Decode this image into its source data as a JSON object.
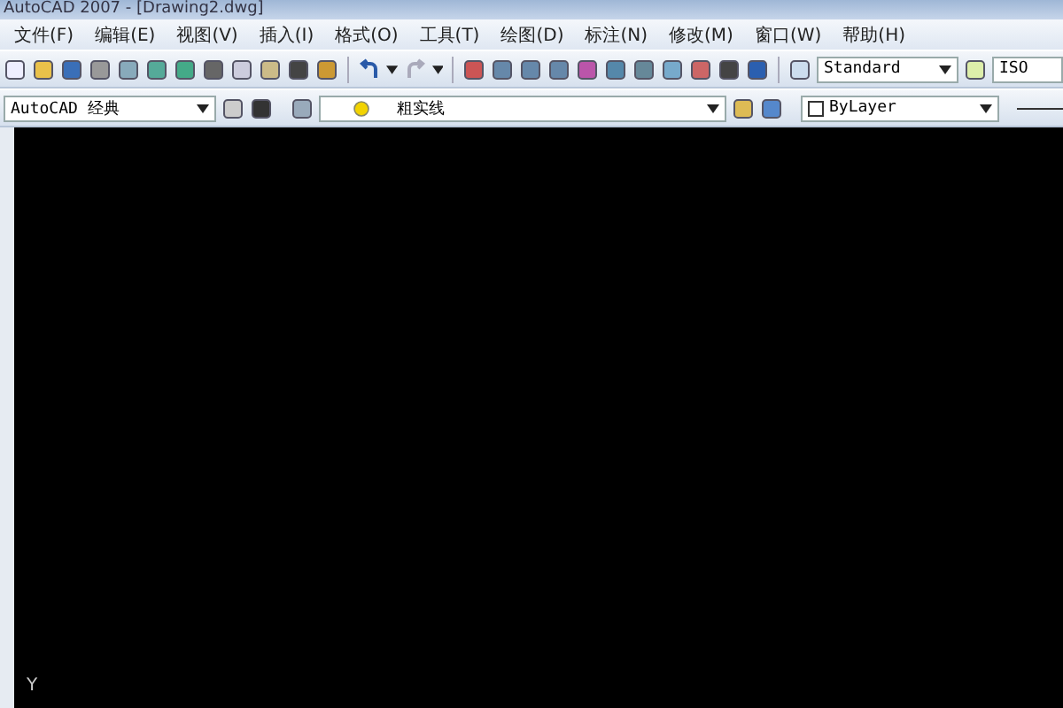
{
  "window": {
    "title": "AutoCAD 2007 - [Drawing2.dwg]"
  },
  "menu": [
    "文件(F)",
    "编辑(E)",
    "视图(V)",
    "插入(I)",
    "格式(O)",
    "工具(T)",
    "绘图(D)",
    "标注(N)",
    "修改(M)",
    "窗口(W)",
    "帮助(H)"
  ],
  "toolbar": {
    "text_style": "Standard",
    "dim_style": "ISO"
  },
  "workspace": {
    "value": "AutoCAD 经典"
  },
  "layer": {
    "name": "粗实线",
    "on": true
  },
  "color": {
    "value": "ByLayer"
  },
  "ucs": {
    "y_label": "Y"
  }
}
